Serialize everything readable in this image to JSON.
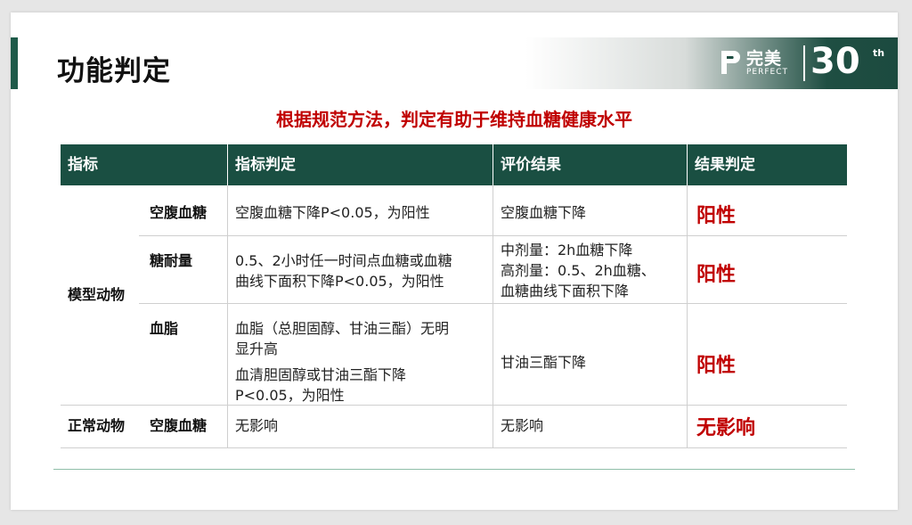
{
  "page_title": "功能判定",
  "logo": {
    "cn": "完美",
    "en": "PERFECT",
    "num": "30",
    "sup": "th"
  },
  "subtitle": "根据规范方法，判定有助于维持血糖健康水平",
  "columns": [
    "指标",
    "指标判定",
    "评价结果",
    "结果判定"
  ],
  "groups": [
    {
      "label": "模型动物"
    },
    {
      "label": "正常动物"
    }
  ],
  "rows": [
    {
      "sub": "空腹血糖",
      "criteria": [
        "空腹血糖下降P<0.05，为阳性"
      ],
      "evaluation": [
        "空腹血糖下降"
      ],
      "verdict": "阳性"
    },
    {
      "sub": "糖耐量",
      "criteria": [
        "0.5、2小时任一时间点血糖或血糖",
        "曲线下面积下降P<0.05，为阳性"
      ],
      "evaluation": [
        "中剂量：2h血糖下降",
        "高剂量：0.5、2h血糖、",
        "血糖曲线下面积下降"
      ],
      "verdict": "阳性"
    },
    {
      "sub": "血脂",
      "criteria": [
        "血脂（总胆固醇、甘油三酯）无明",
        "显升高",
        "血清胆固醇或甘油三酯下降",
        "P<0.05，为阳性"
      ],
      "evaluation": [
        "甘油三酯下降"
      ],
      "verdict": "阳性"
    },
    {
      "sub": "空腹血糖",
      "criteria": [
        "无影响"
      ],
      "evaluation": [
        "无影响"
      ],
      "verdict": "无影响"
    }
  ],
  "colors": {
    "header_bg": "#1a4f42",
    "accent": "#1e5a49",
    "verdict": "#c00000"
  }
}
